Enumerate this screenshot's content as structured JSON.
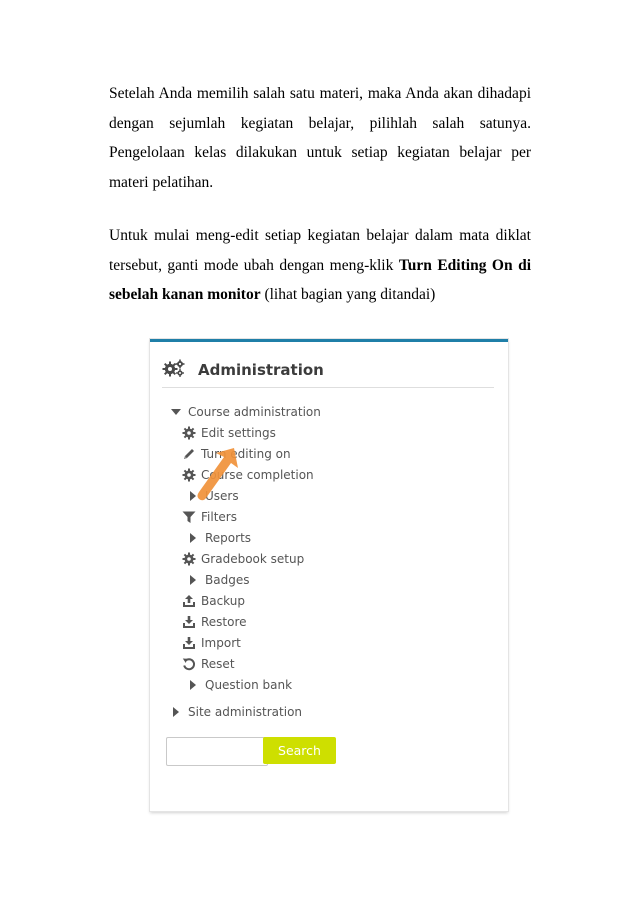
{
  "paragraph1": "Setelah Anda memilih salah satu materi, maka Anda akan dihadapi dengan sejumlah kegiatan belajar, pilihlah salah satunya. Pengelolaan kelas dilakukan untuk setiap kegiatan belajar per materi pelatihan.",
  "paragraph2": {
    "before": "Untuk mulai meng-edit setiap kegiatan belajar dalam mata diklat tersebut, ganti mode ubah dengan meng-klik ",
    "bold": "Turn Editing On di sebelah kanan monitor",
    "after": " (lihat bagian yang ditandai)"
  },
  "screenshot": {
    "header_title": "Administration",
    "course_admin": "Course administration",
    "items": [
      {
        "label": "Edit settings",
        "icon": "gear-icon"
      },
      {
        "label": "Turn editing on",
        "icon": "pencil-icon"
      },
      {
        "label": "Course completion",
        "icon": "gear-icon"
      },
      {
        "label": "Users",
        "icon": "caret-right-icon"
      },
      {
        "label": "Filters",
        "icon": "filter-icon"
      },
      {
        "label": "Reports",
        "icon": "caret-right-icon"
      },
      {
        "label": "Gradebook setup",
        "icon": "gear-icon"
      },
      {
        "label": "Badges",
        "icon": "caret-right-icon"
      },
      {
        "label": "Backup",
        "icon": "upload-icon"
      },
      {
        "label": "Restore",
        "icon": "download-icon"
      },
      {
        "label": "Import",
        "icon": "download-icon"
      },
      {
        "label": "Reset",
        "icon": "reset-icon"
      },
      {
        "label": "Question bank",
        "icon": "caret-right-icon"
      }
    ],
    "site_admin": "Site administration",
    "search_placeholder": "",
    "search_button": "Search",
    "accent_color": "#cedf00",
    "highlight_arrow_color": "#f0913a"
  }
}
